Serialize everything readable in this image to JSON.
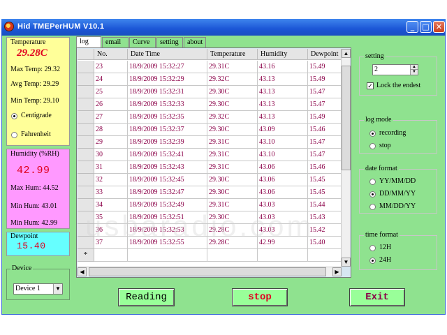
{
  "window": {
    "title": "Hid TMEPerHUM V10.1",
    "controls": {
      "minimize": "_",
      "maximize": "□",
      "close": "✕"
    }
  },
  "temperature": {
    "label": "Temperature",
    "current": "29.28C",
    "max": "Max Temp: 29.32",
    "avg": "Avg Temp: 29.29",
    "min": "Min Temp: 29.10",
    "unit_options": [
      {
        "label": "Centigrade",
        "selected": true
      },
      {
        "label": "Fahrenheit",
        "selected": false
      }
    ]
  },
  "humidity": {
    "label": "Humidity (%RH)",
    "current": "42.99",
    "max": "Max Hum: 44.52",
    "min": "Min Hum: 43.01",
    "min2": "Min Hum: 42.99"
  },
  "dewpoint": {
    "label": "Dewpoint",
    "current": "15.40"
  },
  "device": {
    "label": "Device",
    "selected": "Device 1"
  },
  "tabs": [
    "log",
    "email",
    "Curve",
    "setting",
    "about"
  ],
  "active_tab": "log",
  "table": {
    "columns": [
      "No.",
      "Date Time",
      "Temperature",
      "Humidity",
      "Dewpoint"
    ],
    "rows": [
      [
        "23",
        "18/9/2009  15:32:27",
        "29.31C",
        "43.16",
        "15.49"
      ],
      [
        "24",
        "18/9/2009  15:32:29",
        "29.32C",
        "43.13",
        "15.49"
      ],
      [
        "25",
        "18/9/2009  15:32:31",
        "29.30C",
        "43.13",
        "15.47"
      ],
      [
        "26",
        "18/9/2009  15:32:33",
        "29.30C",
        "43.13",
        "15.47"
      ],
      [
        "27",
        "18/9/2009  15:32:35",
        "29.32C",
        "43.13",
        "15.49"
      ],
      [
        "28",
        "18/9/2009  15:32:37",
        "29.30C",
        "43.09",
        "15.46"
      ],
      [
        "29",
        "18/9/2009  15:32:39",
        "29.31C",
        "43.10",
        "15.47"
      ],
      [
        "30",
        "18/9/2009  15:32:41",
        "29.31C",
        "43.10",
        "15.47"
      ],
      [
        "31",
        "18/9/2009  15:32:43",
        "29.31C",
        "43.06",
        "15.46"
      ],
      [
        "32",
        "18/9/2009  15:32:45",
        "29.30C",
        "43.06",
        "15.45"
      ],
      [
        "33",
        "18/9/2009  15:32:47",
        "29.30C",
        "43.06",
        "15.45"
      ],
      [
        "34",
        "18/9/2009  15:32:49",
        "29.31C",
        "43.03",
        "15.44"
      ],
      [
        "35",
        "18/9/2009  15:32:51",
        "29.30C",
        "43.03",
        "15.43"
      ],
      [
        "36",
        "18/9/2009  15:32:53",
        "29.28C",
        "43.03",
        "15.42"
      ],
      [
        "37",
        "18/9/2009  15:32:55",
        "29.28C",
        "42.99",
        "15.40"
      ]
    ],
    "new_row_marker": "*"
  },
  "setting": {
    "label": "setting",
    "value": "2",
    "lock_label": "Lock the endest",
    "lock_checked": true
  },
  "log_mode": {
    "label": "log mode",
    "options": [
      {
        "label": "recording",
        "selected": true
      },
      {
        "label": "stop",
        "selected": false
      }
    ]
  },
  "date_format": {
    "label": "date format",
    "options": [
      {
        "label": "YY/MM/DD",
        "selected": false
      },
      {
        "label": "DD/MM/YY",
        "selected": true
      },
      {
        "label": "MM/DD/YY",
        "selected": false
      }
    ]
  },
  "time_format": {
    "label": "time format",
    "options": [
      {
        "label": "12H",
        "selected": false
      },
      {
        "label": "24H",
        "selected": true
      }
    ]
  },
  "buttons": {
    "reading": "Reading",
    "stop": "stop",
    "exit": "Exit"
  },
  "watermark": "usbaradio.com",
  "colors": {
    "window_bg": "#8fe28f",
    "temp_panel": "#ffff99",
    "hum_panel": "#ff99ff",
    "dew_panel": "#66ffff",
    "value_red": "#e0001f",
    "cell_text": "#8b0048",
    "stop_text": "#e0001f"
  }
}
